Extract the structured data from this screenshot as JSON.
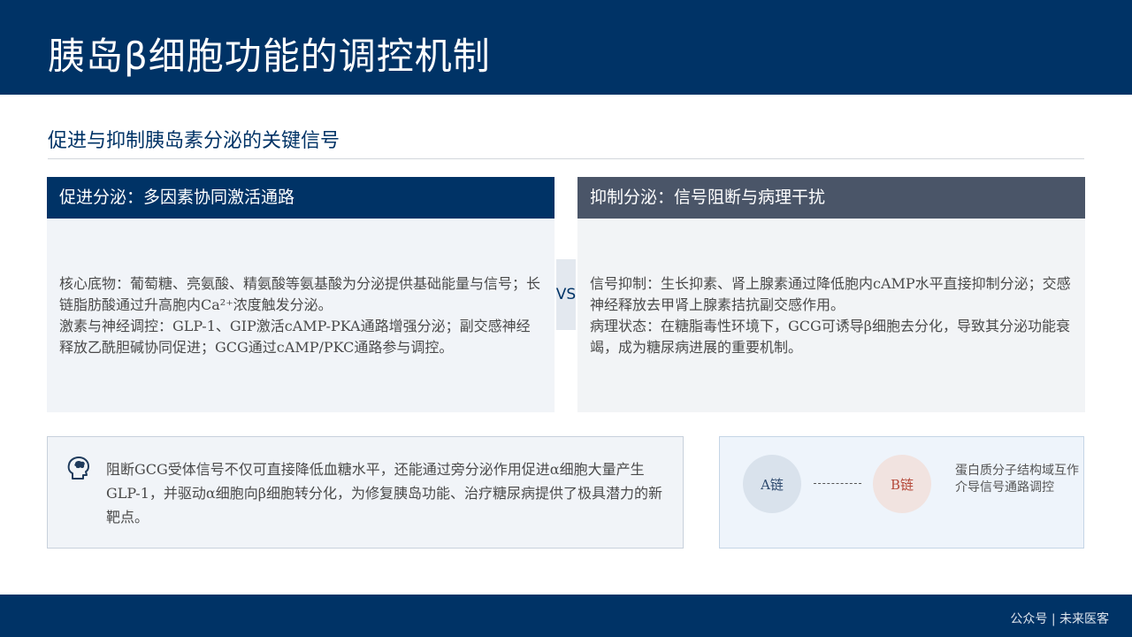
{
  "header": {
    "title": "胰岛β细胞功能的调控机制"
  },
  "section": {
    "subtitle": "促进与抑制胰岛素分泌的关键信号"
  },
  "left_panel": {
    "heading": "促进分泌：多因素协同激活通路",
    "paragraphs": [
      "核心底物：葡萄糖、亮氨酸、精氨酸等氨基酸为分泌提供基础能量与信号；长链脂肪酸通过升高胞内Ca²⁺浓度触发分泌。",
      "激素与神经调控：GLP-1、GIP激活cAMP-PKA通路增强分泌；副交感神经释放乙酰胆碱协同促进；GCG通过cAMP/PKC通路参与调控。"
    ]
  },
  "vs_label": "VS",
  "right_panel": {
    "heading": "抑制分泌：信号阻断与病理干扰",
    "paragraphs": [
      "信号抑制：生长抑素、肾上腺素通过降低胞内cAMP水平直接抑制分泌；交感神经释放去甲肾上腺素拮抗副交感作用。",
      "病理状态：在糖脂毒性环境下，GCG可诱导β细胞去分化，导致其分泌功能衰竭，成为糖尿病进展的重要机制。"
    ]
  },
  "note": {
    "icon": "brain-head-icon",
    "text": "阻断GCG受体信号不仅可直接降低血糖水平，还能通过旁分泌作用促进α细胞大量产生GLP-1，并驱动α细胞向β细胞转分化，为修复胰岛功能、治疗糖尿病提供了极具潜力的新靶点。"
  },
  "diagram": {
    "node_a": "A链",
    "node_b": "B链",
    "caption_line1": "蛋白质分子结构域互作",
    "caption_line2": "介导信号通路调控"
  },
  "footer": {
    "credit": "公众号 | 未来医客"
  },
  "colors": {
    "primary": "#003366",
    "secondary": "#4a5568",
    "panel_bg": "#f1f4f8",
    "accent_red": "#b5493a"
  }
}
